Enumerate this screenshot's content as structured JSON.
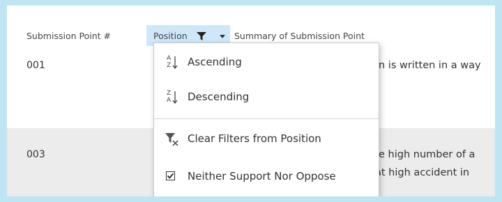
{
  "header": {
    "col_submission_point": "Submission Point #",
    "col_position": "Position",
    "col_summary": "Summary of Submission Point"
  },
  "rows": [
    {
      "id": "001",
      "text_fragment": "n is written in a way"
    },
    {
      "id": "003",
      "text_fragment_1": "e high number of a",
      "text_fragment_2": "at high accident in"
    }
  ],
  "menu": {
    "items": [
      {
        "label": "Ascending",
        "icon": "sort-ascending-icon"
      },
      {
        "label": "Descending",
        "icon": "sort-descending-icon"
      },
      {
        "label": "Clear Filters from Position",
        "icon": "clear-filter-icon"
      },
      {
        "label": "Neither Support Nor Oppose",
        "icon": "checkbox-checked-icon",
        "checked": true
      }
    ]
  },
  "colors": {
    "outer_background": "#bfe4f2",
    "active_header": "#cfe8f9",
    "alt_row": "#ececec"
  }
}
